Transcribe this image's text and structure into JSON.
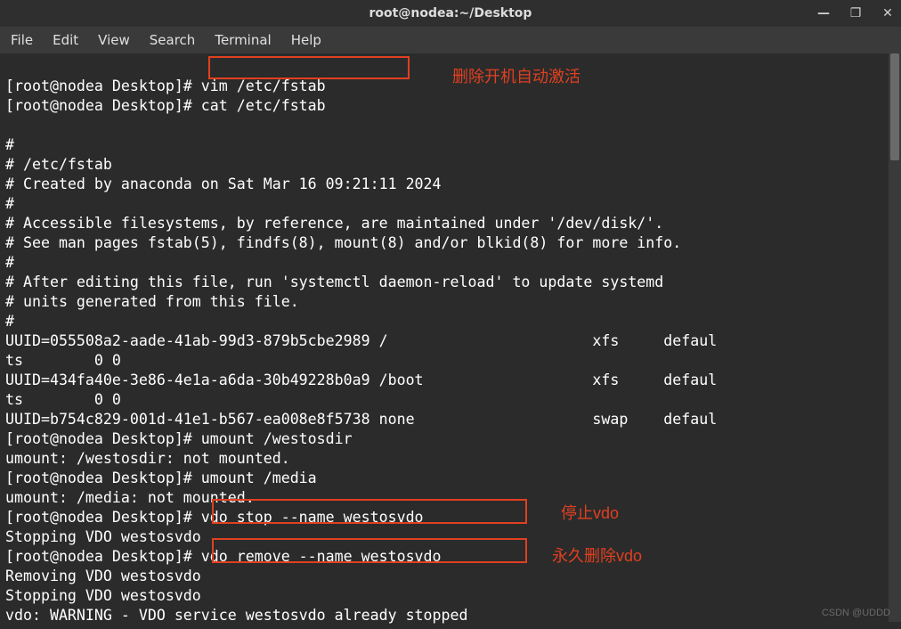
{
  "window": {
    "title": "root@nodea:~/Desktop"
  },
  "menu": {
    "file": "File",
    "edit": "Edit",
    "view": "View",
    "search": "Search",
    "terminal": "Terminal",
    "help": "Help"
  },
  "term": {
    "l01": "[root@nodea Desktop]# vim /etc/fstab",
    "l02": "[root@nodea Desktop]# cat /etc/fstab",
    "l03": "",
    "l04": "#",
    "l05": "# /etc/fstab",
    "l06": "# Created by anaconda on Sat Mar 16 09:21:11 2024",
    "l07": "#",
    "l08": "# Accessible filesystems, by reference, are maintained under '/dev/disk/'.",
    "l09": "# See man pages fstab(5), findfs(8), mount(8) and/or blkid(8) for more info.",
    "l10": "#",
    "l11": "# After editing this file, run 'systemctl daemon-reload' to update systemd",
    "l12": "# units generated from this file.",
    "l13": "#",
    "l14": "UUID=055508a2-aade-41ab-99d3-879b5cbe2989 /                       xfs     defaul",
    "l15": "ts        0 0",
    "l16": "UUID=434fa40e-3e86-4e1a-a6da-30b49228b0a9 /boot                   xfs     defaul",
    "l17": "ts        0 0",
    "l18": "UUID=b754c829-001d-41e1-b567-ea008e8f5738 none                    swap    defaul",
    "l19": "[root@nodea Desktop]# umount /westosdir",
    "l20": "umount: /westosdir: not mounted.",
    "l21": "[root@nodea Desktop]# umount /media",
    "l22": "umount: /media: not mounted.",
    "l23": "[root@nodea Desktop]# vdo stop --name westosvdo",
    "l24": "Stopping VDO westosvdo",
    "l25": "[root@nodea Desktop]# vdo remove --name westosvdo",
    "l26": "Removing VDO westosvdo",
    "l27": "Stopping VDO westosvdo",
    "l28": "vdo: WARNING - VDO service westosvdo already stopped"
  },
  "annotations": {
    "a1": "删除开机自动激活",
    "a2": "停止vdo",
    "a3": "永久删除vdo"
  },
  "watermark": "CSDN @UDDD"
}
